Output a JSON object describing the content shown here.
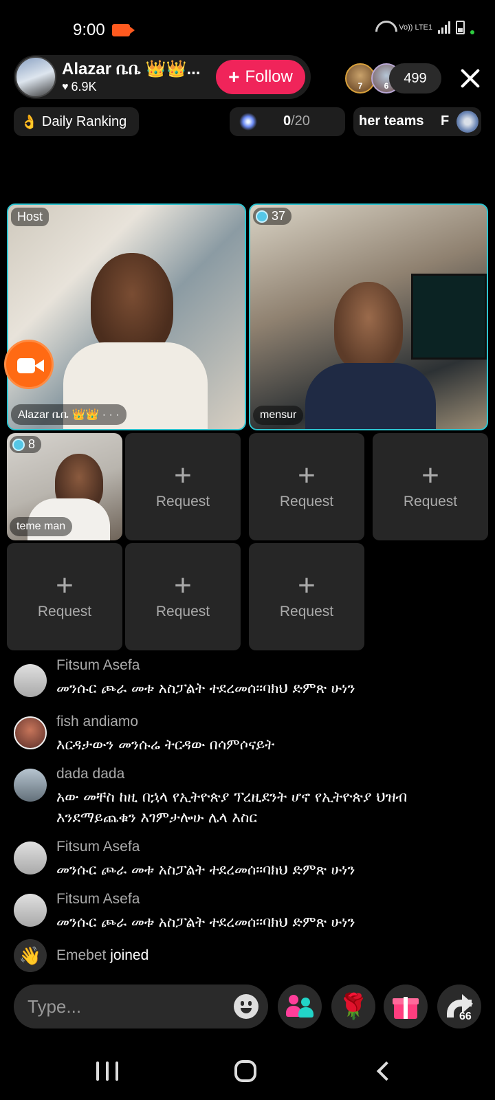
{
  "status_bar": {
    "time": "9:00",
    "network": "Vo)) LTE1"
  },
  "header": {
    "host_name": "Alazar ቤቤ 👑👑...",
    "host_likes": "6.9K",
    "follow_label": "Follow",
    "viewer_badge_1": "7",
    "viewer_badge_2": "6",
    "viewer_count": "499"
  },
  "ranking": {
    "label": "Daily Ranking",
    "progress_current": "0",
    "progress_total": "/20",
    "teams_label": "her teams",
    "teams_letter": "F"
  },
  "video_grid": {
    "host_tag": "Host",
    "host_name": "Alazar ቤቤ 👑👑 · · ·",
    "guest1_badge": "37",
    "guest1_name": "mensur",
    "guest2_badge": "8",
    "guest2_name": "teme man",
    "request_label": "Request"
  },
  "chat": {
    "messages": [
      {
        "user": "Fitsum Asefa",
        "text": "መንሱር  ጮራ   መቱ አስፓልት  ተደረመሰ።ባክህ ድምጽ ሁነን"
      },
      {
        "user": "fish andiamo",
        "text": "እርዳታውን መንሱሬ ትርዳው በሳምሶናይት"
      },
      {
        "user": "dada dada",
        "text": "አው መቸስ ከዚ በኋላ የኢትዮጵያ ፕረዚደንት ሆኖ የኢትዮጵያ ህዝብ እንደማይጨቁን እገምታሎሁ ሌላ እስር"
      },
      {
        "user": "Fitsum Asefa",
        "text": "መንሱር  ጮራ   መቱ አስፓልት  ተደረመሰ።ባክህ ድምጽ ሁነን"
      },
      {
        "user": "Fitsum Asefa",
        "text": "መንሱር  ጮራ   መቱ አስፓልት  ተደረመሰ።ባክህ ድምጽ ሁነን"
      }
    ],
    "join_user": "Emebet",
    "join_text": "joined"
  },
  "bottom_bar": {
    "input_placeholder": "Type...",
    "share_count": "66"
  },
  "colors": {
    "follow": "#f0245a",
    "tile_border": "#2ec4d0",
    "camera_fab": "#ff6a13"
  }
}
